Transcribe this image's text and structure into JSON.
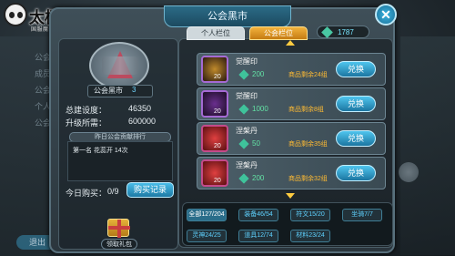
{
  "logo": {
    "title": "太极熊猫",
    "subtitle": "国服魔幻全球动作手游"
  },
  "background": {
    "left_items": [
      "公会",
      "成员",
      "公会",
      "个人",
      "公会"
    ],
    "exit_label": "退出"
  },
  "dialog": {
    "title": "公会黑市",
    "tabs": [
      {
        "label": "个人栏位"
      },
      {
        "label": "公会栏位"
      }
    ],
    "currency": {
      "value": "1787",
      "icon": "gem-icon"
    }
  },
  "guild": {
    "name": "公会黑市",
    "level": "3",
    "stats": [
      {
        "label": "总建设度：",
        "value": "46350"
      },
      {
        "label": "升级所需：",
        "value": "600000"
      }
    ],
    "rank_header": "昨日公会贡献排行",
    "rank_rows": [
      "第一名 花蕊开 14次"
    ],
    "today_buy_label": "今日购买：",
    "today_buy_value": "0/9",
    "record_button": "购买记录",
    "gift_label": "领取礼包"
  },
  "items": [
    {
      "name": "觉醒印",
      "qty": "20",
      "price": "200",
      "stock": "商品剩余24组",
      "button": "兑换"
    },
    {
      "name": "觉醒印",
      "qty": "20",
      "price": "1000",
      "stock": "商品剩余8组",
      "button": "兑换"
    },
    {
      "name": "涅槃丹",
      "qty": "20",
      "price": "50",
      "stock": "商品剩余35组",
      "button": "兑换"
    },
    {
      "name": "涅槃丹",
      "qty": "20",
      "price": "200",
      "stock": "商品剩余32组",
      "button": "兑换"
    }
  ],
  "filters": [
    {
      "label": "全部127/204"
    },
    {
      "label": "装备46/54"
    },
    {
      "label": "符文15/20"
    },
    {
      "label": "坐骑7/7"
    },
    {
      "label": "灵神24/25"
    },
    {
      "label": "道具12/74"
    },
    {
      "label": "材料23/24"
    }
  ],
  "colors": {
    "accent": "#49bde8",
    "gold": "#ffbb33",
    "price": "#63e2a5"
  }
}
